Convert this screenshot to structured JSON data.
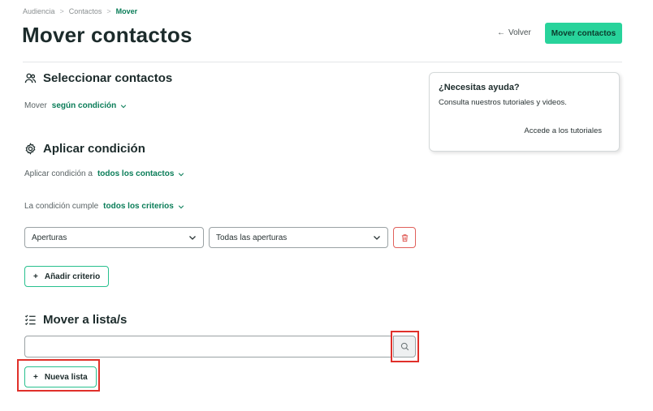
{
  "breadcrumb": {
    "items": [
      "Audiencia",
      "Contactos"
    ],
    "current": "Mover",
    "separator": ">"
  },
  "header": {
    "title": "Mover contactos",
    "back_label": "Volver",
    "primary_label": "Mover contactos"
  },
  "select_contacts": {
    "title": "Seleccionar contactos",
    "mode_label": "Mover",
    "mode_value": "según condición"
  },
  "apply_condition": {
    "title": "Aplicar condición",
    "apply_to_label": "Aplicar condición a",
    "apply_to_value": "todos los contactos",
    "match_label": "La condición cumple",
    "match_value": "todos los criterios",
    "criterion_field": "Aperturas",
    "criterion_value": "Todas las aperturas",
    "add_criterion_label": "Añadir criterio"
  },
  "move_to": {
    "title": "Mover a lista/s",
    "search_value": "",
    "new_list_label": "Nueva lista"
  },
  "help": {
    "title": "¿Necesitas ayuda?",
    "text": "Consulta nuestros tutoriales y videos.",
    "link": "Accede a los tutoriales"
  },
  "colors": {
    "accent": "#28d39b",
    "accent_text": "#0a7d58",
    "danger": "#e0605b",
    "highlight": "#e0302a"
  },
  "icons": [
    "arrow-left-icon",
    "users-icon",
    "gear-icon",
    "chevron-down-icon",
    "trash-icon",
    "plus-icon",
    "list-icon",
    "search-icon"
  ]
}
